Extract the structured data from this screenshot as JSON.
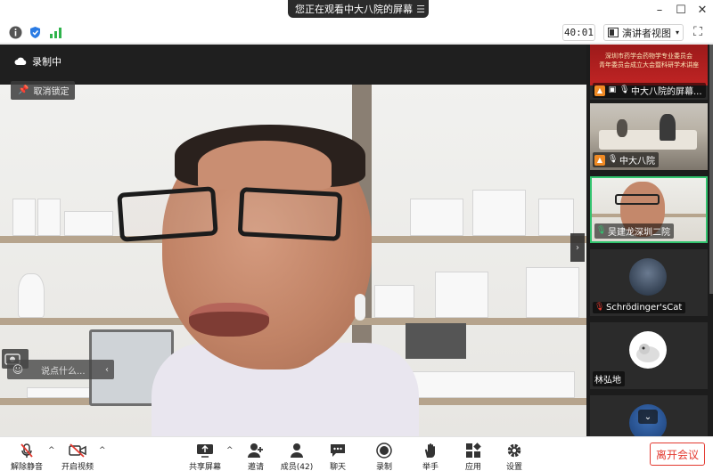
{
  "window": {
    "title": "您正在观看中大八院的屏幕",
    "controls": [
      "minimize-icon",
      "maximize-icon",
      "close-icon"
    ]
  },
  "infobar": {
    "timer": "40:01",
    "view_label": "演讲者视图",
    "icons": [
      "info-icon",
      "shield-icon",
      "signal-icon"
    ]
  },
  "main_video": {
    "recording_label": "录制中",
    "unlock_label": "取消锁定",
    "chat_placeholder": "说点什么..."
  },
  "participants": [
    {
      "name": "中大八院的屏幕...",
      "banner_line1": "深圳市药学会药物学专业委员会",
      "banner_line2": "青年委员会成立大会暨科研学术讲座",
      "type": "screen"
    },
    {
      "name": "中大八院",
      "type": "room"
    },
    {
      "name": "吴建龙深圳二院",
      "type": "speaker",
      "active": true
    },
    {
      "name": "Schrödinger'sCat",
      "type": "avatar"
    },
    {
      "name": "林弘地",
      "type": "avatar"
    }
  ],
  "toolbar": {
    "unmute": "解除静音",
    "start_video": "开启视频",
    "share_screen": "共享屏幕",
    "invite": "邀请",
    "members": "成员(42)",
    "chat": "聊天",
    "record": "录制",
    "raise_hand": "举手",
    "apps": "应用",
    "settings": "设置",
    "leave": "离开会议"
  },
  "colors": {
    "active_border": "#32c36e",
    "leave_red": "#e3392f",
    "presenter_orange": "#f08a24",
    "mute_red": "#e3392f"
  }
}
